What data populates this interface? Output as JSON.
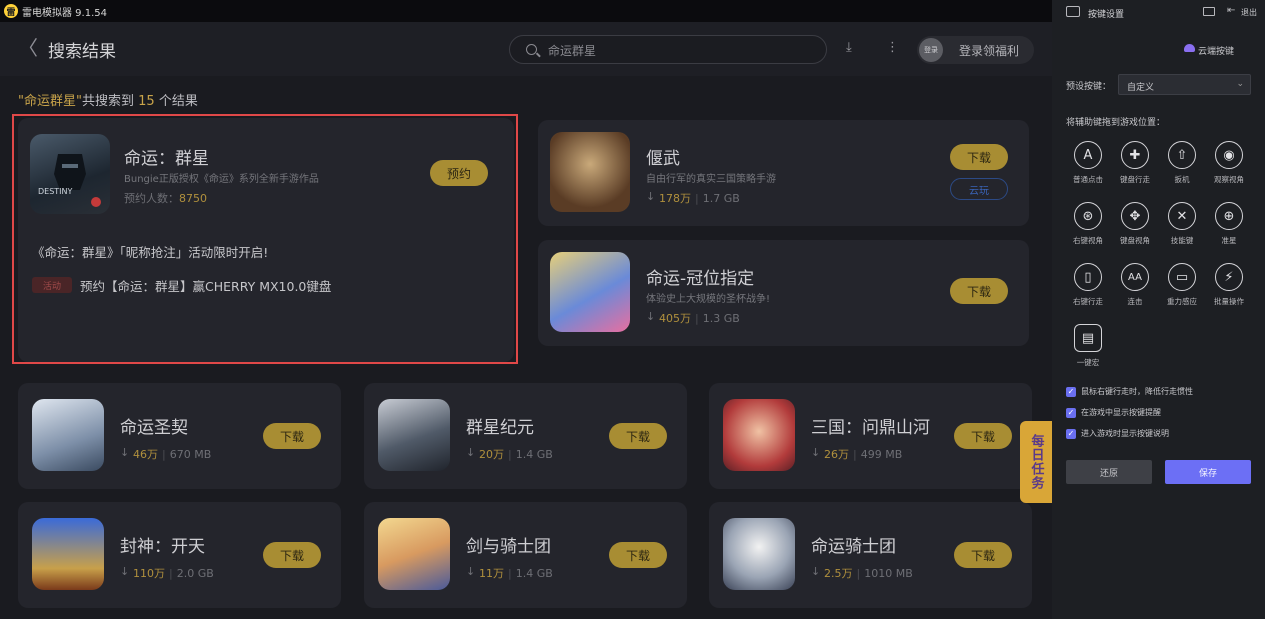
{
  "titlebar": {
    "logo_char": "雷",
    "title": "雷电模拟器 9.1.54"
  },
  "header": {
    "back_glyph": "〈",
    "title": "搜索结果",
    "search_value": "命运群星",
    "download_glyph": "⤓",
    "more_glyph": "⋮",
    "avatar_text": "登录",
    "login_label": "登录领福利"
  },
  "summary": {
    "q_open": "\"",
    "query": "命运群星",
    "q_close": "\"",
    "prefix": "共搜索到",
    "count": "15",
    "suffix": "个结果"
  },
  "featured": {
    "title": "命运：群星",
    "desc": "Bungie正版授权《命运》系列全新手游作品",
    "reserve_prefix": "预约人数：",
    "reserve_count": "8750",
    "button": "预约",
    "promo": "《命运：群星》「昵称抢注」活动限时开启!",
    "tag": "活动",
    "activity": "预约【命运：群星】赢CHERRY MX10.0键盘"
  },
  "games": [
    {
      "title": "偃武",
      "desc": "自由行军的真实三国策略手游",
      "count": "178万",
      "size": "1.7 GB",
      "button": "下载",
      "cloud": "云玩"
    },
    {
      "title": "命运-冠位指定",
      "desc": "体验史上大规模的圣杯战争!",
      "count": "405万",
      "size": "1.3 GB",
      "button": "下载"
    },
    {
      "title": "命运圣契",
      "count": "46万",
      "size": "670 MB",
      "button": "下载"
    },
    {
      "title": "群星纪元",
      "count": "20万",
      "size": "1.4 GB",
      "button": "下载"
    },
    {
      "title": "三国：问鼎山河",
      "count": "26万",
      "size": "499 MB",
      "button": "下载"
    },
    {
      "title": "封神：开天",
      "count": "110万",
      "size": "2.0 GB",
      "button": "下载"
    },
    {
      "title": "剑与骑士团",
      "count": "11万",
      "size": "1.4 GB",
      "button": "下载"
    },
    {
      "title": "命运骑士团",
      "count": "2.5万",
      "size": "1010 MB",
      "button": "下载"
    }
  ],
  "daily_badge": "每日任务",
  "panel": {
    "title": "按键设置",
    "exit": "退出",
    "cloud_keys": "云端按键",
    "preset_label": "预设按键：",
    "preset_value": "自定义",
    "drag_label": "将辅助键拖到游戏位置：",
    "keys": [
      {
        "label": "普通点击",
        "glyph": "A"
      },
      {
        "label": "键盘行走",
        "glyph": "✚"
      },
      {
        "label": "扳机",
        "glyph": "⇧"
      },
      {
        "label": "观察视角",
        "glyph": "◉"
      },
      {
        "label": "右键视角",
        "glyph": "⊛"
      },
      {
        "label": "键盘视角",
        "glyph": "✥"
      },
      {
        "label": "技能键",
        "glyph": "✕"
      },
      {
        "label": "准星",
        "glyph": "⊕"
      },
      {
        "label": "右键行走",
        "glyph": "▯"
      },
      {
        "label": "连击",
        "glyph": "AA"
      },
      {
        "label": "重力感应",
        "glyph": "▭"
      },
      {
        "label": "批量操作",
        "glyph": "⚡"
      },
      {
        "label": "一键宏",
        "glyph": "▤"
      }
    ],
    "options": [
      "鼠标右键行走时，降低行走惯性",
      "在游戏中显示按键提醒",
      "进入游戏时显示按键说明"
    ],
    "reset": "还原",
    "save": "保存"
  },
  "colors": {
    "accent_gold": "#a88d33",
    "brand_purple": "#6c6ff5",
    "highlight_red": "#e04848"
  }
}
